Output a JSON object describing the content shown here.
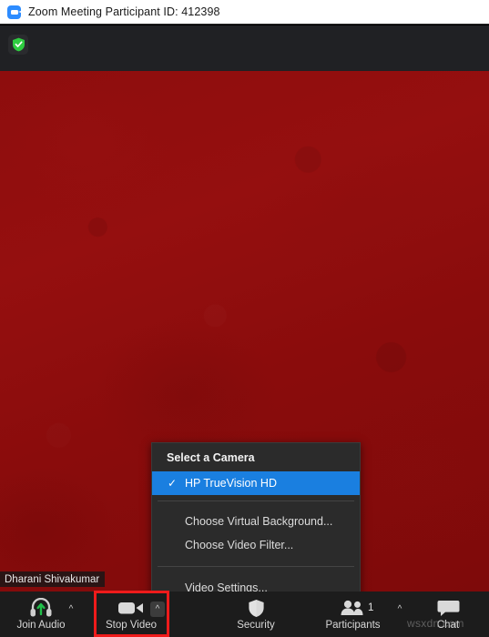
{
  "window": {
    "title": "Zoom Meeting Participant ID: 412398",
    "app_icon": "zoom-camera-icon"
  },
  "header": {
    "encryption_icon": "green-shield-check-icon"
  },
  "video": {
    "background_color": "#8e0d0d",
    "participant_name": "Dharani Shivakumar"
  },
  "camera_menu": {
    "header": "Select a Camera",
    "cameras": [
      {
        "label": "HP TrueVision HD",
        "selected": true,
        "check_glyph": "✓"
      }
    ],
    "options": [
      {
        "label": "Choose Virtual Background..."
      },
      {
        "label": "Choose Video Filter..."
      }
    ],
    "settings": [
      {
        "label": "Video Settings..."
      }
    ],
    "highlight_color": "#1a7fe0"
  },
  "toolbar": {
    "background_color": "#1c1c1c",
    "items": [
      {
        "name": "join-audio",
        "label": "Join Audio",
        "icon": "headset-icon",
        "has_caret": true
      },
      {
        "name": "stop-video",
        "label": "Stop Video",
        "icon": "video-camera-icon",
        "has_caret": true,
        "highlighted": true
      },
      {
        "name": "security",
        "label": "Security",
        "icon": "shield-icon",
        "has_caret": false
      },
      {
        "name": "participants",
        "label": "Participants",
        "icon": "people-icon",
        "has_caret": true,
        "count": "1"
      },
      {
        "name": "chat",
        "label": "Chat",
        "icon": "chat-bubble-icon",
        "has_caret": false
      }
    ],
    "highlight_color": "#ef1b1b"
  },
  "watermark": {
    "text": "wsxdn.com"
  }
}
